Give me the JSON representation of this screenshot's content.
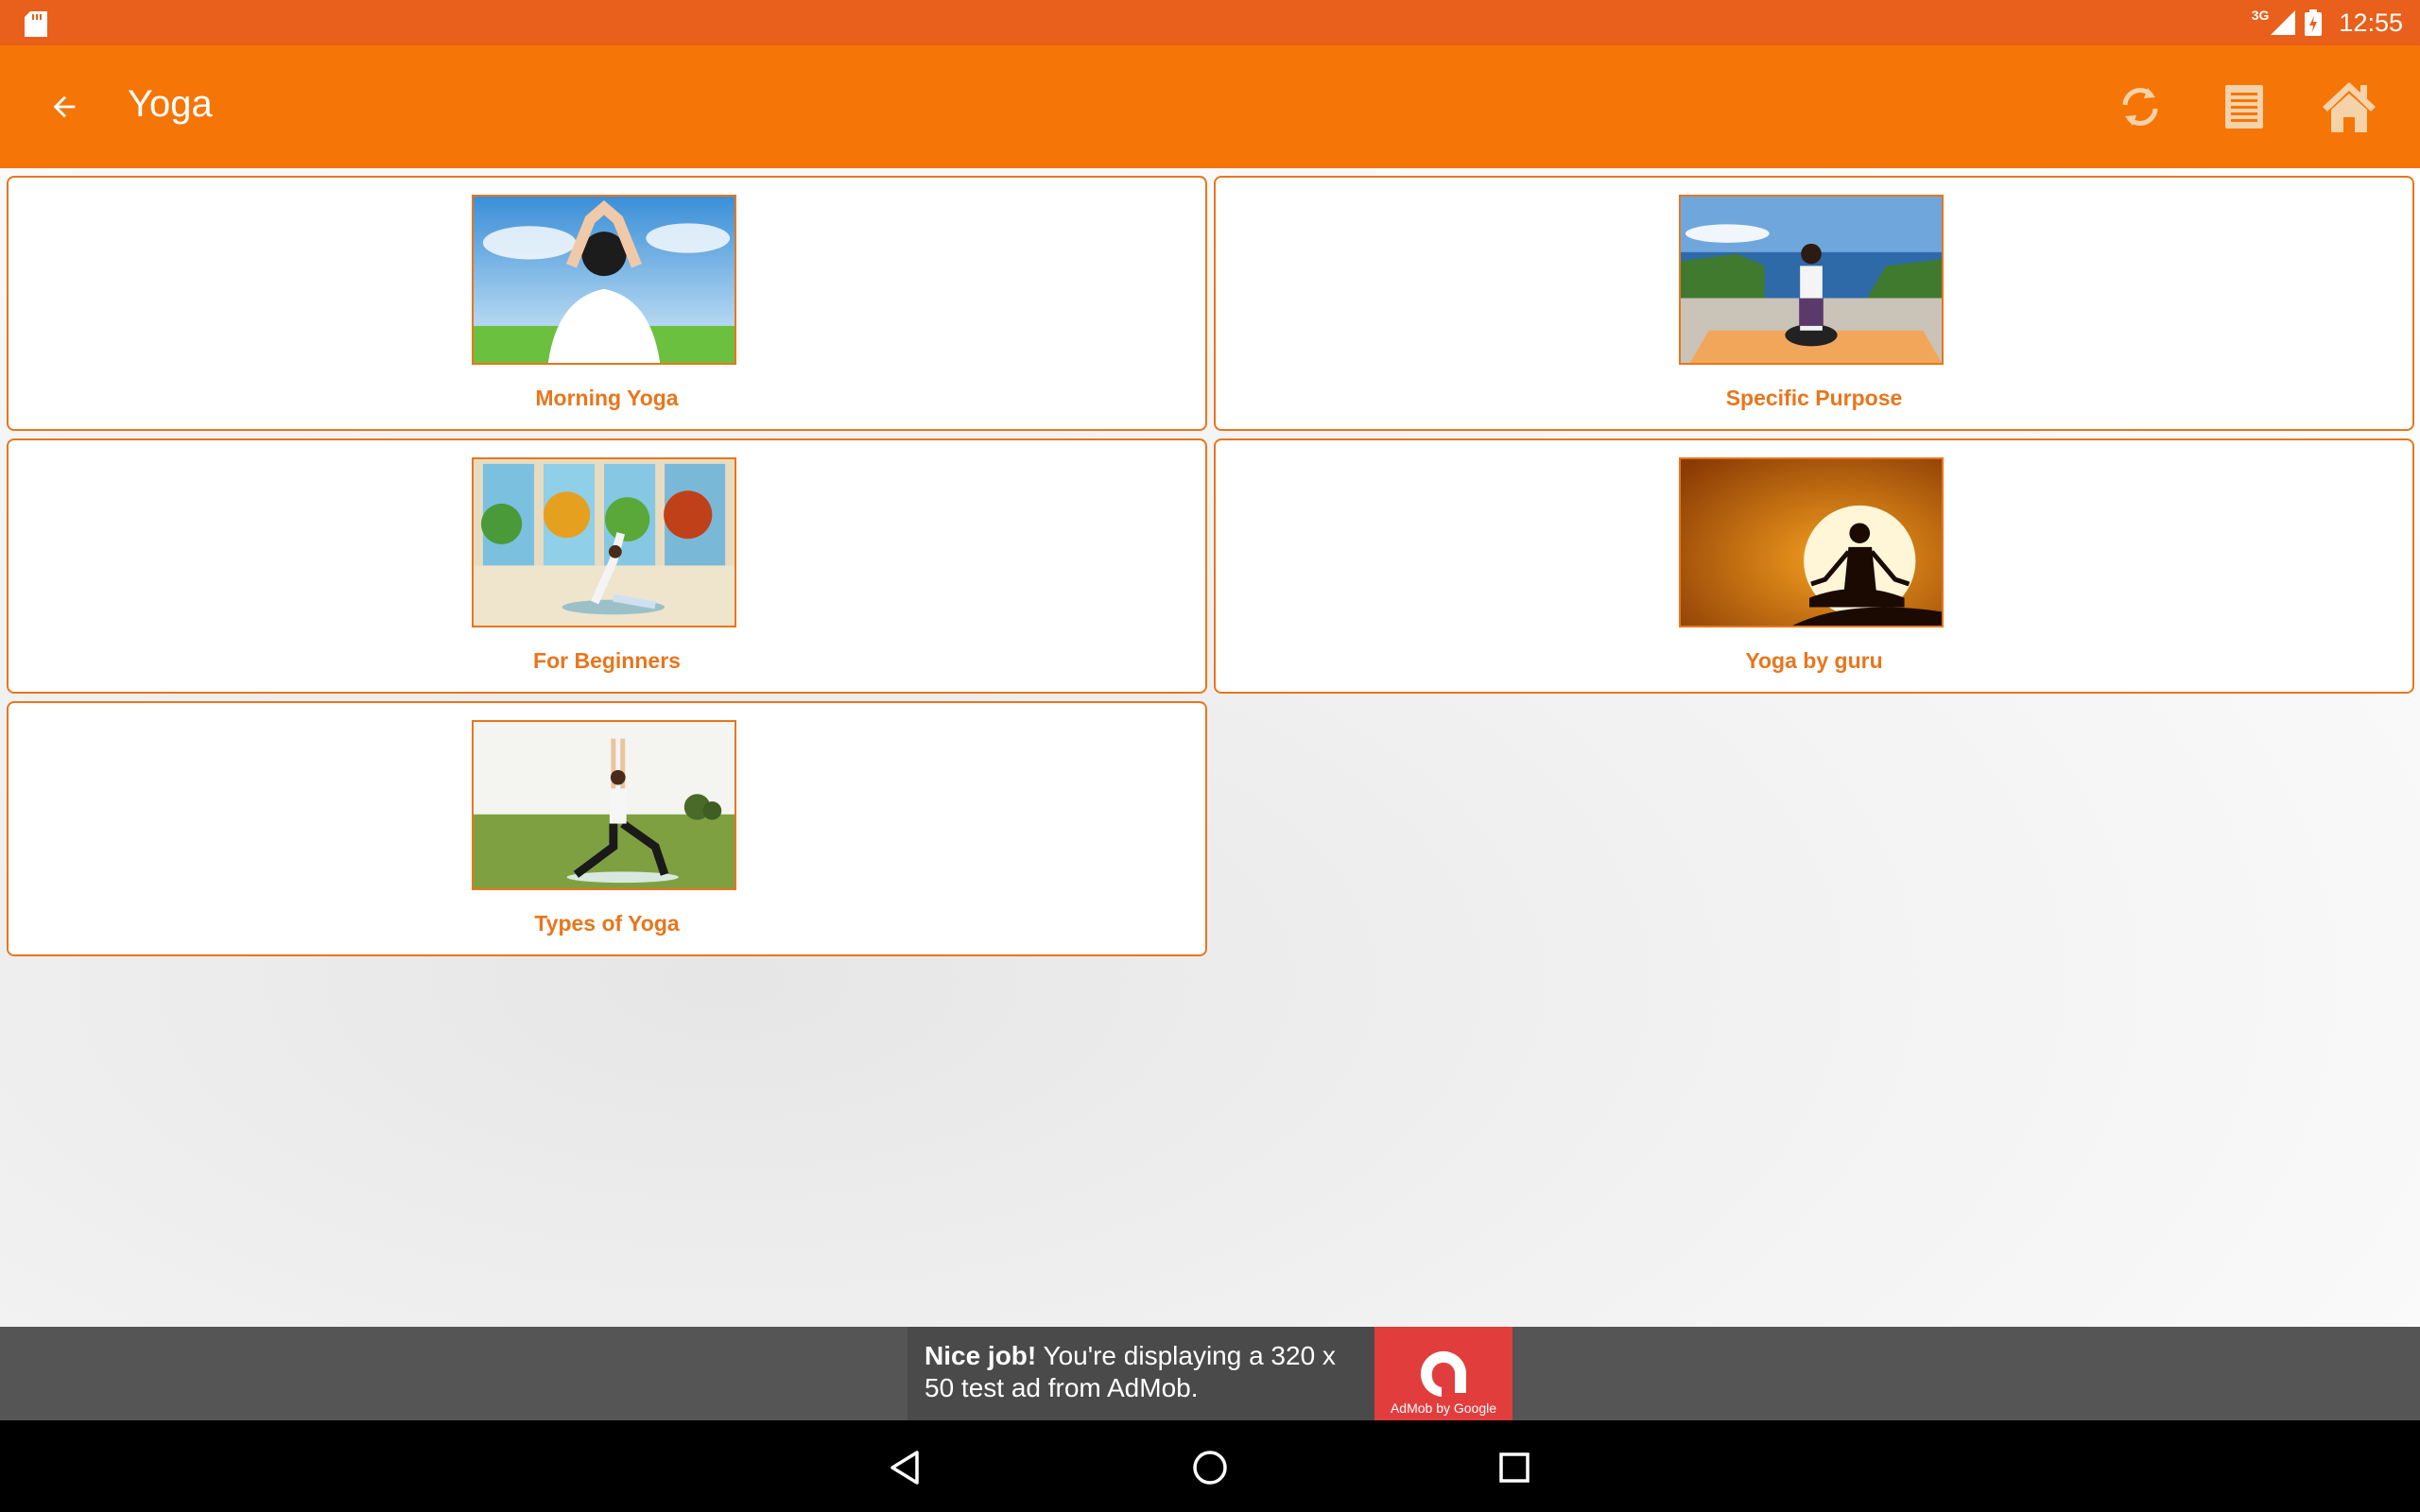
{
  "status_bar": {
    "network_label": "3G",
    "time": "12:55"
  },
  "app_bar": {
    "title": "Yoga",
    "actions": [
      "refresh-icon",
      "list-icon",
      "home-icon"
    ],
    "colors": {
      "app_bar": "#F57507",
      "status_bar": "#E8601B",
      "accent": "#E8761D"
    }
  },
  "categories": [
    {
      "label": "Morning Yoga",
      "image": "morning-yoga-image"
    },
    {
      "label": "Specific Purpose",
      "image": "specific-purpose-image"
    },
    {
      "label": "For Beginners",
      "image": "for-beginners-image"
    },
    {
      "label": "Yoga by guru",
      "image": "yoga-by-guru-image"
    },
    {
      "label": "Types of Yoga",
      "image": "types-of-yoga-image"
    }
  ],
  "ad": {
    "headline": "Nice job!",
    "body": " You're displaying a 320 x 50 test ad from AdMob.",
    "logo_text": "AdMob by Google"
  },
  "nav_bar": {
    "buttons": [
      "back-triangle-icon",
      "home-circle-icon",
      "recents-square-icon"
    ]
  }
}
